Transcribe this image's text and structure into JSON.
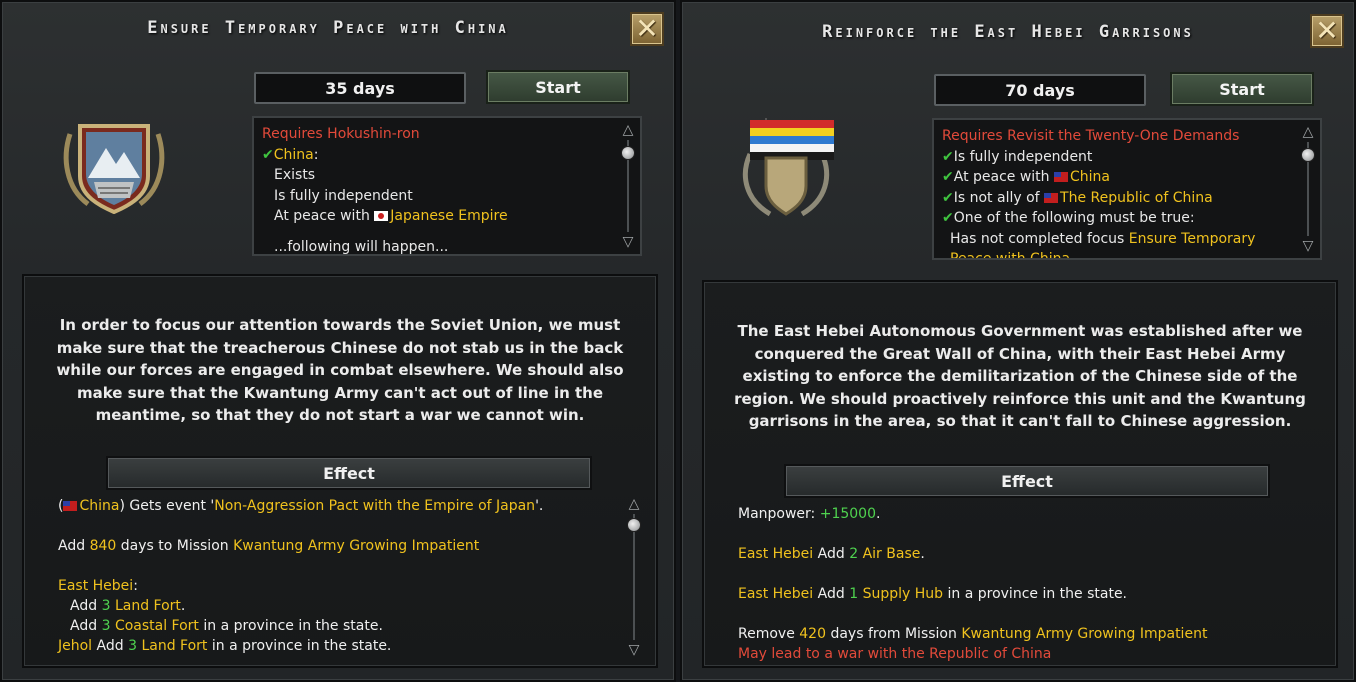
{
  "left": {
    "title": "Ensure Temporary Peace with China",
    "duration": "35 days",
    "start_label": "Start",
    "requirements": {
      "requires_prefix": "Requires ",
      "requires_focus": "Hokushin-ron",
      "country": "China",
      "country_suffix": ":",
      "items": [
        "Exists",
        "Is fully independent"
      ],
      "at_peace_prefix": "At peace with ",
      "at_peace_target": "Japanese Empire",
      "cut_line": "...following will happen..."
    },
    "description": "In order to focus our attention towards the Soviet Union, we must make sure that the treacherous Chinese do not stab us in the back while our forces are engaged in combat elsewhere. We should also make sure that the Kwantung Army can't act out of line in the meantime, so that they do not start a war we cannot win.",
    "effect_label": "Effect",
    "effects": {
      "e1_open": "(",
      "e1_country": "China",
      "e1_mid": ") Gets event '",
      "e1_event": "Non-Aggression Pact with the Empire of Japan",
      "e1_close": "'.",
      "e2_add": "Add ",
      "e2_days": "840",
      "e2_mid": " days to Mission ",
      "e2_mission": "Kwantung Army Growing Impatient",
      "e3_state": "East Hebei",
      "e3_colon": ":",
      "e4_add": "Add ",
      "e4_num": "3",
      "e4_sp": " ",
      "e4_building": "Land Fort",
      "e4_end": ".",
      "e5_add": "Add ",
      "e5_num": "3",
      "e5_sp": " ",
      "e5_building": "Coastal Fort",
      "e5_end": " in a province in the state.",
      "e6_state": "Jehol",
      "e6_add": " Add ",
      "e6_num": "3",
      "e6_sp": " ",
      "e6_building": "Land Fort",
      "e6_end": " in a province in the state."
    }
  },
  "right": {
    "title": "Reinforce the East Hebei Garrisons",
    "duration": "70 days",
    "start_label": "Start",
    "requirements": {
      "requires_prefix": "Requires ",
      "requires_focus": "Revisit the Twenty-One Demands",
      "r1": "Is fully independent",
      "r2_prefix": "At peace with ",
      "r2_target": "China",
      "r3_prefix": "Is not ally of ",
      "r3_target": "The Republic of China",
      "r4": "One of the following must be true:",
      "r5_prefix": "Has not completed focus ",
      "r5_focus": "Ensure Temporary",
      "r6_cut": "Peace with China"
    },
    "description": "The East Hebei Autonomous Government was established after we conquered the Great Wall of China, with their East Hebei Army existing to enforce the demilitarization of the Chinese side of the region. We should proactively reinforce this unit and the Kwantung garrisons in the area, so that it can't fall to Chinese aggression.",
    "effect_label": "Effect",
    "effects": {
      "e1_label": "Manpower: ",
      "e1_value": "+15000",
      "e1_end": ".",
      "e2_state": "East Hebei",
      "e2_add": " Add ",
      "e2_num": "2",
      "e2_sp": " ",
      "e2_building": "Air Base",
      "e2_end": ".",
      "e3_state": "East Hebei",
      "e3_add": " Add ",
      "e3_num": "1",
      "e3_sp": " ",
      "e3_building": "Supply Hub",
      "e3_end": " in a province in the state.",
      "e4_remove": "Remove ",
      "e4_days": "420",
      "e4_mid": " days from Mission ",
      "e4_mission": "Kwantung Army Growing Impatient",
      "e5_warning": "May lead to a war with the Republic of China"
    }
  },
  "colors": {
    "requirement_red": "#e24a3a",
    "highlight_yellow": "#f0c21e",
    "positive_green": "#4fd24f",
    "start_button": "#3b4c3b"
  },
  "icons": [
    "close-icon",
    "checkmark-icon",
    "scroll-up-icon",
    "scroll-down-icon",
    "mountain-fortress-emblem",
    "flag-shield-emblem",
    "japan-flag-icon",
    "china-flag-icon"
  ]
}
